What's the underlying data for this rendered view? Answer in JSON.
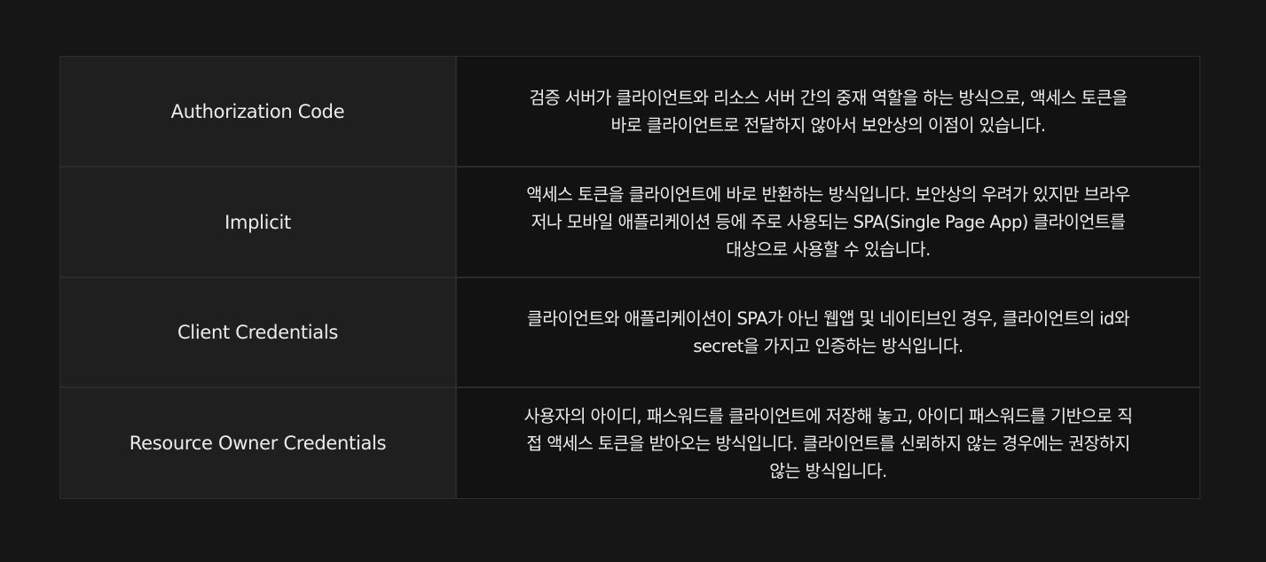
{
  "grant_table": {
    "rows": [
      {
        "type": "Authorization Code",
        "lines": [
          "검증 서버가 클라이언트와 리소스 서버 간의 중재 역할을 하는 방식으로, 액세스 토큰을",
          "바로 클라이언트로 전달하지 않아서 보안상의 이점이 있습니다."
        ]
      },
      {
        "type": "Implicit",
        "lines": [
          "액세스 토큰을 클라이언트에 바로 반환하는 방식입니다. 보안상의 우려가 있지만 브라우",
          "저나 모바일 애플리케이션 등에 주로 사용되는 SPA(Single Page App) 클라이언트를",
          "대상으로 사용할 수 있습니다."
        ]
      },
      {
        "type": "Client Credentials",
        "lines": [
          "클라이언트와 애플리케이션이 SPA가 아닌 웹앱 및 네이티브인 경우, 클라이언트의 id와",
          "secret을 가지고 인증하는 방식입니다."
        ]
      },
      {
        "type": "Resource Owner Credentials",
        "lines": [
          "사용자의 아이디, 패스워드를 클라이언트에 저장해 놓고, 아이디 패스워드를 기반으로 직",
          "접 액세스 토큰을 받아오는 방식입니다. 클라이언트를 신뢰하지 않는 경우에는 권장하지",
          "않는 방식입니다."
        ]
      }
    ]
  }
}
